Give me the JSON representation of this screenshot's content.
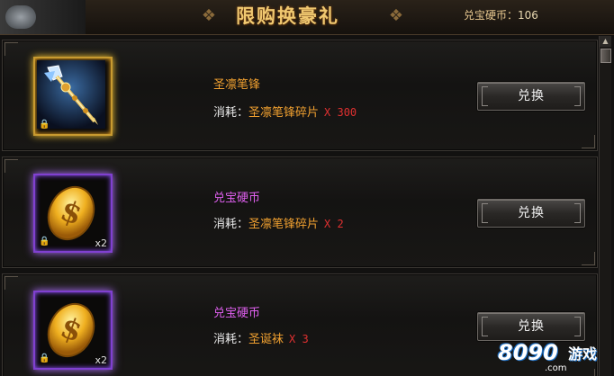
{
  "header": {
    "title": "限购换豪礼",
    "currency_label": "兑宝硬币：",
    "currency_value": "106"
  },
  "items": [
    {
      "name": "圣凛笔锋",
      "name_color": "orange",
      "frame": "gold",
      "icon": "spear-icon",
      "quantity": "",
      "cost_label": "消耗：",
      "cost_material": "圣凛笔锋碎片",
      "cost_multiplier": "X 300",
      "button_label": "兑换"
    },
    {
      "name": "兑宝硬币",
      "name_color": "purple",
      "frame": "purple",
      "icon": "gold-coin-icon",
      "quantity": "x2",
      "cost_label": "消耗：",
      "cost_material": "圣凛笔锋碎片",
      "cost_multiplier": "X 2",
      "button_label": "兑换"
    },
    {
      "name": "兑宝硬币",
      "name_color": "purple",
      "frame": "purple",
      "icon": "gold-coin-icon",
      "quantity": "x2",
      "cost_label": "消耗：",
      "cost_material": "圣诞袜",
      "cost_multiplier": "X 3",
      "button_label": "兑换"
    }
  ],
  "watermark": {
    "logo": "8090",
    "game": "游戏",
    "domain": ".com"
  },
  "colors": {
    "gold_frame": "#c89a30",
    "purple_frame": "#8040d0",
    "orange_text": "#f0a030",
    "purple_text": "#e060f0",
    "red_multiplier": "#e03030"
  }
}
